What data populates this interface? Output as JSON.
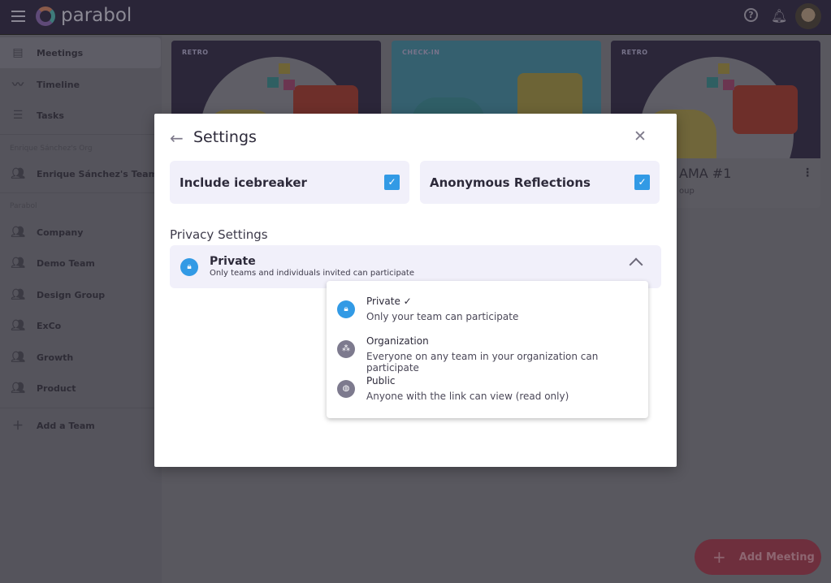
{
  "header": {
    "brand": "parabol",
    "icons": [
      "menu-icon",
      "help-icon",
      "bell-icon",
      "avatar"
    ]
  },
  "sidebar": {
    "items": [
      {
        "label": "Meetings",
        "icon": "meetings-icon"
      },
      {
        "label": "Timeline",
        "icon": "timeline-icon"
      },
      {
        "label": "Tasks",
        "icon": "tasks-icon"
      }
    ],
    "org_group": "Enrique Sánchez's Org",
    "org_teams": [
      "Enrique Sánchez's Team"
    ],
    "parabol_group": "Parabol",
    "teams": [
      "Company",
      "Demo Team",
      "Design Group",
      "ExCo",
      "Growth",
      "Product"
    ],
    "add_team": "Add a Team"
  },
  "cards": [
    {
      "tag": "RETRO"
    },
    {
      "tag": "CHECK-IN"
    },
    {
      "tag": "RETRO",
      "title": "AMA #1",
      "subtitle": "oup"
    }
  ],
  "modal": {
    "title": "Settings",
    "options": [
      {
        "label": "Include icebreaker",
        "checked": true
      },
      {
        "label": "Anonymous Reflections",
        "checked": true
      }
    ],
    "privacy_heading": "Privacy Settings",
    "selected": {
      "label": "Private",
      "description": "Only teams and individuals invited can participate"
    },
    "dropdown": [
      {
        "label": "Private",
        "check": "✓",
        "description": "Only your team can participate",
        "icon": "lock-icon"
      },
      {
        "label": "Organization",
        "description": "Everyone on any team in your organization can participate",
        "icon": "group-icon"
      },
      {
        "label": "Public",
        "description": "Anyone with the link can view (read only)",
        "icon": "globe-icon"
      }
    ]
  },
  "fab": {
    "label": "Add Meeting"
  },
  "colors": {
    "accent": "#329ae5",
    "header": "#2a2538",
    "fab": "#e34c6a"
  }
}
